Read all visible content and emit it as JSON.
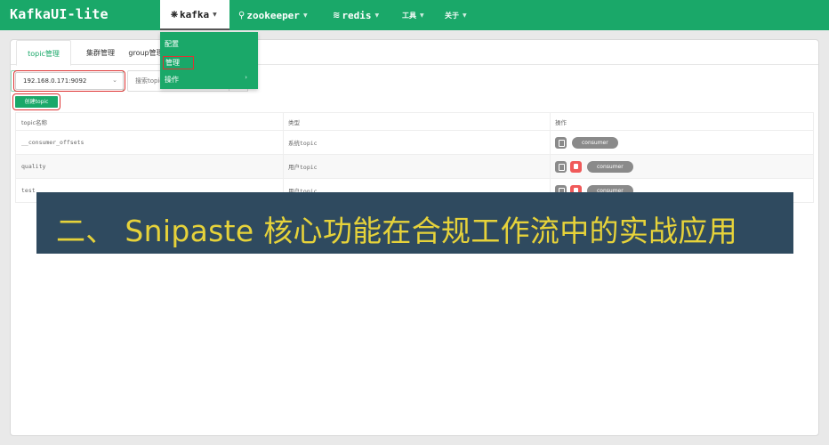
{
  "app": {
    "title": "KafkaUI-lite"
  },
  "nav": {
    "kafka": "kafka",
    "zookeeper": "zookeeper",
    "redis": "redis",
    "tools": "工具",
    "about": "关于"
  },
  "kafka_menu": {
    "items": [
      "配置",
      "管理",
      "操作"
    ]
  },
  "tabs": [
    "topic管理",
    "集群管理",
    "group管理"
  ],
  "filter": {
    "server_value": "192.168.0.171:9092",
    "search_placeholder": "搜索topic"
  },
  "create_button": "创建topic",
  "table": {
    "headers": [
      "topic名称",
      "类型",
      "操作"
    ],
    "rows": [
      {
        "name": "__consumer_offsets",
        "type": "系统topic",
        "consumer_label": "consumer"
      },
      {
        "name": "quality",
        "type": "用户topic",
        "consumer_label": "consumer"
      },
      {
        "name": "test",
        "type": "用户topic",
        "consumer_label": "consumer"
      }
    ]
  },
  "overlay": {
    "text": "二、 Snipaste 核心功能在合规工作流中的实战应用"
  },
  "colors": {
    "primary": "#1aa869",
    "danger": "#f05a5a",
    "overlay_bg": "#2f4a5f",
    "overlay_text": "#e6d23a"
  }
}
